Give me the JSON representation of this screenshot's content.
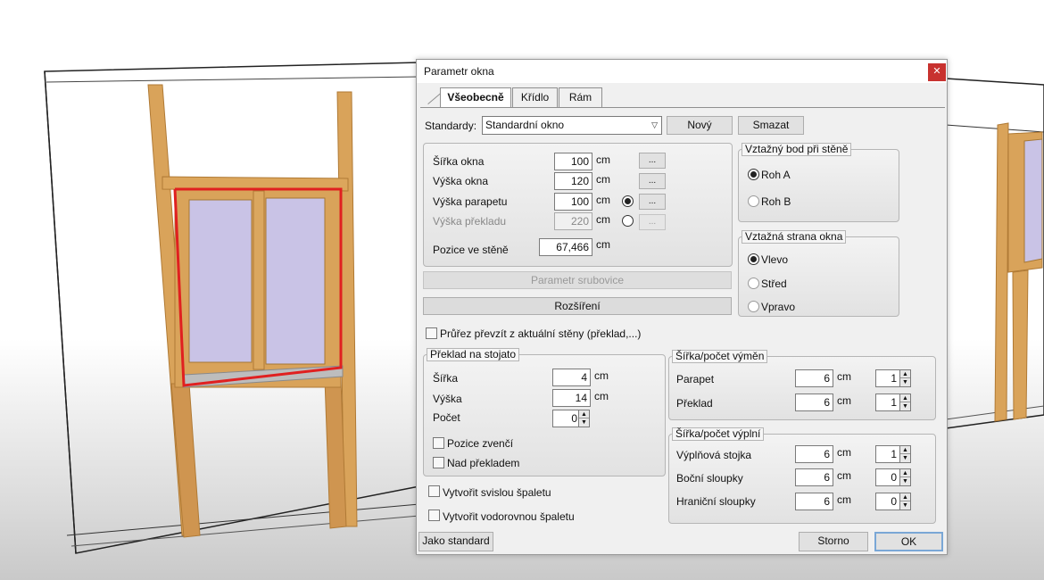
{
  "dialog": {
    "title": "Parametr okna",
    "close_icon": "close-icon",
    "tabs": [
      {
        "label": "Všeobecně",
        "active": true
      },
      {
        "label": "Křídlo",
        "active": false
      },
      {
        "label": "Rám",
        "active": false
      }
    ],
    "standards": {
      "label": "Standardy:",
      "selected": "Standardní okno",
      "new_button": "Nový",
      "delete_button": "Smazat"
    },
    "dimensions": {
      "width": {
        "label": "Šířka okna",
        "value": "100",
        "unit": "cm"
      },
      "height": {
        "label": "Výška okna",
        "value": "120",
        "unit": "cm"
      },
      "parapet_height": {
        "label": "Výška parapetu",
        "value": "100",
        "unit": "cm"
      },
      "lintel_height": {
        "label": "Výška překladu",
        "value": "220",
        "unit": "cm"
      },
      "position": {
        "label": "Pozice ve stěně",
        "value": "67,466",
        "unit": "cm"
      },
      "dots_label": "..."
    },
    "log_param_button": "Parametr srubovice",
    "extension_button": "Rozšíření",
    "reference_point": {
      "title": "Vztažný bod při stěně",
      "options": [
        "Roh A",
        "Roh B"
      ],
      "selected": "Roh A"
    },
    "reference_side": {
      "title": "Vztažná strana okna",
      "options": [
        "Vlevo",
        "Střed",
        "Vpravo"
      ],
      "selected": "Vlevo"
    },
    "take_section_checkbox": "Průřez převzít z aktuální stěny (překlad,...)",
    "upright_lintel": {
      "title": "Překlad na stojato",
      "width": {
        "label": "Šířka",
        "value": "4",
        "unit": "cm"
      },
      "height": {
        "label": "Výška",
        "value": "14",
        "unit": "cm"
      },
      "count": {
        "label": "Počet",
        "value": "0"
      },
      "outside_position": "Pozice zvenčí",
      "above_lintel": "Nad překladem"
    },
    "cutout": {
      "title": "Šířka/počet výměn",
      "parapet": {
        "label": "Parapet",
        "value": "6",
        "unit": "cm",
        "count": "1"
      },
      "lintel": {
        "label": "Překlad",
        "value": "6",
        "unit": "cm",
        "count": "1"
      }
    },
    "fill": {
      "title": "Šířka/počet výplní",
      "fill_stud": {
        "label": "Výplňová stojka",
        "value": "6",
        "unit": "cm",
        "count": "1"
      },
      "side_posts": {
        "label": "Boční sloupky",
        "value": "6",
        "unit": "cm",
        "count": "0"
      },
      "edge_posts": {
        "label": "Hraniční sloupky",
        "value": "6",
        "unit": "cm",
        "count": "0"
      }
    },
    "vertical_reveal": "Vytvořit svislou špaletu",
    "horizontal_reveal": "Vytvořit vodorovnou špaletu",
    "as_standard_button": "Jako standard",
    "cancel_button": "Storno",
    "ok_button": "OK"
  },
  "colors": {
    "close_red": "#c8322f",
    "wood": "#d9a35a",
    "selection_red": "#e02020",
    "glass": "#c9c3e6"
  }
}
